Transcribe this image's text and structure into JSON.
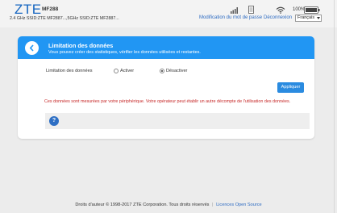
{
  "header": {
    "logo": "ZTE",
    "model": "MF288",
    "ssid": "2.4 GHz SSID:ZTE MF2887...,5GHz SSID:ZTE MF2887...",
    "change_password_link": "Modification du mot de passe",
    "logout_link": "Déconnexion",
    "battery_percent": "100%",
    "language": "Français"
  },
  "panel": {
    "title": "Limitation des données",
    "subtitle": "Vous pouvez créer des statistiques, vérifier les données utilisées et restantes.",
    "row_label": "Limitation des données",
    "option_enable": "Activer",
    "option_disable": "Désactiver",
    "selected_option": "Désactiver",
    "apply_label": "Appliquer",
    "warning": "Ces données sont mesurées par votre périphérique. Votre opérateur peut établir un autre décompte de l'utilisation des données.",
    "help_glyph": "?"
  },
  "footer": {
    "copyright": "Droits d'auteur © 1998-2017 ZTE Corporation. Tous droits réservés",
    "separator": "|",
    "oss_link": "Licences Open Source"
  },
  "colors": {
    "accent": "#2196f3",
    "button": "#2a8be0",
    "warning": "#c62828",
    "link": "#2d6bc2"
  }
}
